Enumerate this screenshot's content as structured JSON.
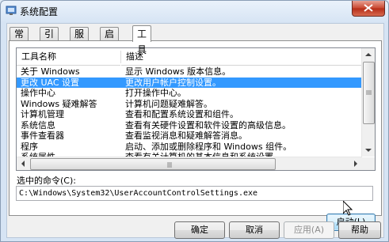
{
  "window": {
    "title": "系统配置",
    "icon": "msconfig-app-icon",
    "close_icon": "close-x-icon"
  },
  "tabs": [
    {
      "label": "常规",
      "active": false
    },
    {
      "label": "引导",
      "active": false
    },
    {
      "label": "服务",
      "active": false
    },
    {
      "label": "启动",
      "active": false
    },
    {
      "label": "工具",
      "active": true
    }
  ],
  "tools_list": {
    "columns": [
      "工具名称",
      "描述"
    ],
    "rows": [
      {
        "name": "关于 Windows",
        "desc": "显示 Windows 版本信息。",
        "selected": false
      },
      {
        "name": "更改 UAC 设置",
        "desc": "更改用户帐户控制设置。",
        "selected": true
      },
      {
        "name": "操作中心",
        "desc": "打开操作中心。",
        "selected": false
      },
      {
        "name": "Windows 疑难解答",
        "desc": "计算机问题疑难解答。",
        "selected": false
      },
      {
        "name": "计算机管理",
        "desc": "查看和配置系统设置和组件。",
        "selected": false
      },
      {
        "name": "系统信息",
        "desc": "查看有关硬件设置和软件设置的高级信息。",
        "selected": false
      },
      {
        "name": "事件查看器",
        "desc": "查看监视消息和疑难解答消息。",
        "selected": false
      },
      {
        "name": "程序",
        "desc": "启动、添加或删除程序和 Windows 组件。",
        "selected": false
      },
      {
        "name": "系统属性",
        "desc": "查看有关计算机的基本信息和系统设置。",
        "selected": false
      }
    ]
  },
  "command": {
    "label": "选中的命令(C):",
    "value": "C:\\Windows\\System32\\UserAccountControlSettings.exe"
  },
  "buttons": {
    "launch": "启动(L)",
    "ok": "确定",
    "cancel": "取消",
    "apply": "应用(A)",
    "help": "帮助"
  },
  "colors": {
    "selection": "#3399ff",
    "close_button": "#c8462f"
  }
}
